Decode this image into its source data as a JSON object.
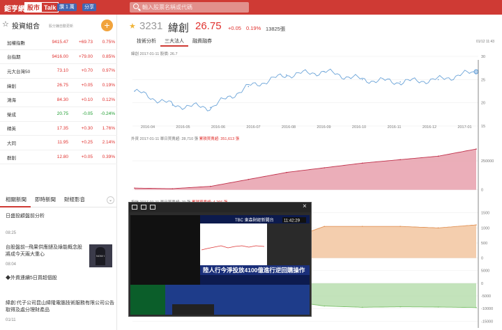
{
  "header": {
    "logo": "鉅亨網",
    "logo_tag": "股市",
    "logo_tag2": "Talk",
    "like_label": "讚 1 萬",
    "share_label": "分享",
    "search_placeholder": "輸入股票名稱或代碼"
  },
  "portfolio": {
    "title": "投資組合",
    "subtitle": "股分鐘自動更新",
    "add_label": "+",
    "rows": [
      {
        "name": "加權指數",
        "price": "9415.47",
        "change": "+69.73",
        "pct": "0.75%",
        "dir": "up"
      },
      {
        "name": "台指期",
        "price": "9416.00",
        "change": "+79.00",
        "pct": "0.85%",
        "dir": "up"
      },
      {
        "name": "元大台灣50",
        "price": "73.10",
        "change": "+0.70",
        "pct": "0.97%",
        "dir": "up"
      },
      {
        "name": "緯創",
        "price": "26.75",
        "change": "+0.05",
        "pct": "0.19%",
        "dir": "up"
      },
      {
        "name": "鴻海",
        "price": "84.30",
        "change": "+0.10",
        "pct": "0.12%",
        "dir": "up"
      },
      {
        "name": "榮成",
        "price": "20.75",
        "change": "-0.05",
        "pct": "-0.24%",
        "dir": "dn"
      },
      {
        "name": "精英",
        "price": "17.35",
        "change": "+0.30",
        "pct": "1.76%",
        "dir": "up"
      },
      {
        "name": "大同",
        "price": "11.95",
        "change": "+0.25",
        "pct": "2.14%",
        "dir": "up"
      },
      {
        "name": "群創",
        "price": "12.80",
        "change": "+0.05",
        "pct": "0.39%",
        "dir": "up"
      }
    ]
  },
  "news": {
    "tabs": [
      "相關新聞",
      "即時新聞",
      "財經影音"
    ],
    "items": [
      {
        "title": "日盛投顧盤前分析",
        "time": "08:25"
      },
      {
        "title": "台股盤前─飛果供應鏈及綠能概念股將成今天兩大重心",
        "time": "08:04"
      },
      {
        "title": "◆外資連續5日買超個股",
        "time": ""
      },
      {
        "title": "緯創:代子公司昆山緯隆電腦技術服務有限公司公告取得及處分理財產品",
        "time": "01/11"
      }
    ],
    "thumb_text": "NOW I"
  },
  "quote": {
    "code": "3231",
    "name": "緯創",
    "price": "26.75",
    "change": "+0.05",
    "pct": "0.19%",
    "volume": "13825張",
    "time": "01/12 11:43",
    "tabs": [
      "技術分析",
      "三大法人",
      "融資融券"
    ]
  },
  "charts": {
    "price_label": "緯創 2017-01-11 股價: 26.7",
    "foreign_label_a": "外資 2017-01-11 單日買賣超: 28,710 張",
    "foreign_label_b": "累積買賣超: 351,613 張",
    "third_label_a": "投信 2017-01-11 單日買賣超: 79 張",
    "third_label_b": "累積買賣超: 4,266 張",
    "y_price": [
      "30",
      "25",
      "20",
      "15"
    ],
    "y_foreign": [
      "250000",
      "0"
    ],
    "y_third": [
      "1500",
      "1000",
      "500",
      "0"
    ],
    "y_fourth": [
      "5000",
      "0",
      "-5000",
      "-10000",
      "-15000"
    ],
    "x_labels": [
      "2016-04",
      "2016-05",
      "2016-06",
      "2016-07",
      "2016-08",
      "2016-09",
      "2016-10",
      "2016-11",
      "2016-12",
      "2017-01"
    ]
  },
  "video": {
    "ticker_title": "陸人行今淨投放4100億進行逆回購操作",
    "channel": "TBC 東森財經新聞台",
    "clock": "11:42:29"
  },
  "chart_data": [
    {
      "type": "line",
      "title": "緯創 2017-01-11 股價: 26.7",
      "x": [
        "2016-04",
        "2016-05",
        "2016-06",
        "2016-07",
        "2016-08",
        "2016-09",
        "2016-10",
        "2016-11",
        "2016-12",
        "2017-01"
      ],
      "values": [
        22.5,
        19.5,
        19.0,
        23.5,
        26.0,
        26.7,
        25.0,
        24.5,
        25.0,
        26.7
      ],
      "ylim": [
        15,
        30
      ]
    },
    {
      "type": "area",
      "title": "外資 2017-01-11 單日買賣超: 28,710 張",
      "x": [
        "2016-04",
        "2016-05",
        "2016-06",
        "2016-07",
        "2016-08",
        "2016-09",
        "2016-10",
        "2016-11",
        "2016-12",
        "2017-01"
      ],
      "values": [
        15000,
        10000,
        30000,
        90000,
        150000,
        190000,
        230000,
        260000,
        290000,
        351613
      ],
      "ylim": [
        -80000,
        400000
      ]
    },
    {
      "type": "area",
      "title": "投信 2017-01-11 單日買賣超: 79 張",
      "x": [
        "2016-04",
        "2016-05",
        "2016-06",
        "2016-07",
        "2016-08",
        "2016-09",
        "2016-10",
        "2016-11",
        "2016-12",
        "2017-01"
      ],
      "values": [
        0,
        0,
        0,
        0,
        600,
        1050,
        1050,
        1050,
        1000,
        1100
      ],
      "ylim": [
        -100,
        1700
      ]
    },
    {
      "type": "area",
      "x": [
        "2016-04",
        "2016-05",
        "2016-06",
        "2016-07",
        "2016-08",
        "2016-09",
        "2016-10",
        "2016-11",
        "2016-12",
        "2017-01"
      ],
      "values": [
        0,
        -1000,
        -2500,
        -5000,
        -7000,
        -9000,
        -9500,
        -9300,
        -9400,
        -9600
      ],
      "ylim": [
        -16000,
        6000
      ]
    }
  ]
}
